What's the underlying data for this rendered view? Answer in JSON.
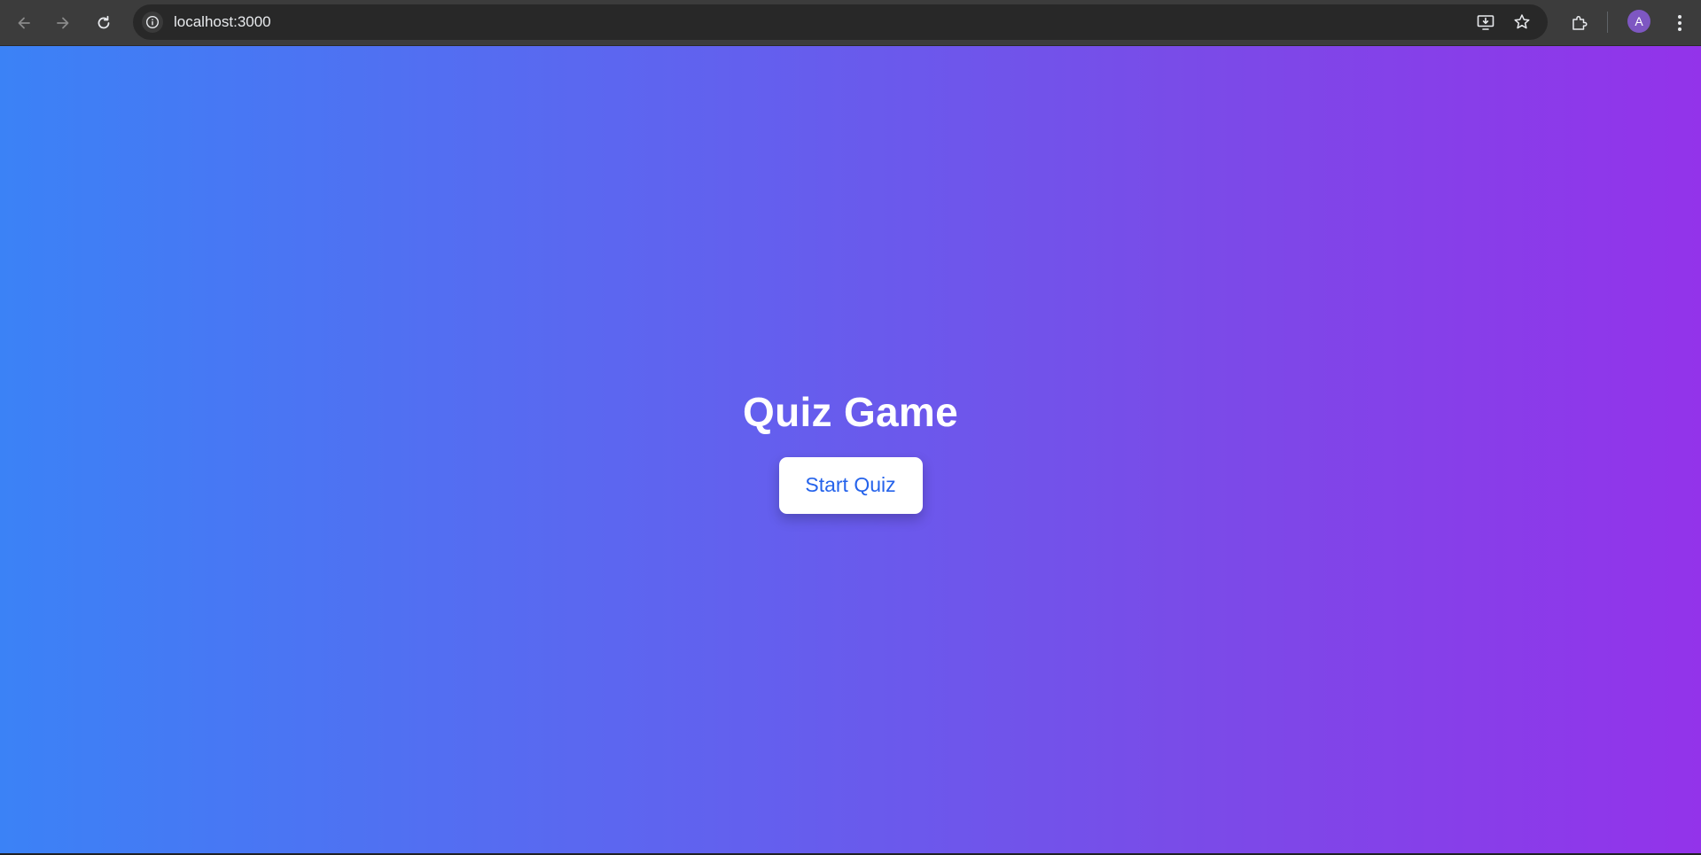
{
  "browser": {
    "url": "localhost:3000",
    "profile_initial": "A",
    "icons": {
      "back": "back-arrow-icon",
      "forward": "forward-arrow-icon",
      "reload": "reload-icon",
      "site_info": "info-icon",
      "install": "install-app-icon",
      "bookmark": "star-icon",
      "extensions": "puzzle-icon",
      "menu": "kebab-menu-icon"
    },
    "colors": {
      "toolbar": "#3c3c3c",
      "omnibox": "#282828",
      "avatar": "#7e57c2"
    }
  },
  "page": {
    "title": "Quiz Game",
    "start_button_label": "Start Quiz",
    "colors": {
      "gradient_start": "#3b82f6",
      "gradient_end": "#9333ea",
      "button_bg": "#ffffff",
      "button_text": "#2563eb",
      "title_text": "#ffffff"
    }
  }
}
